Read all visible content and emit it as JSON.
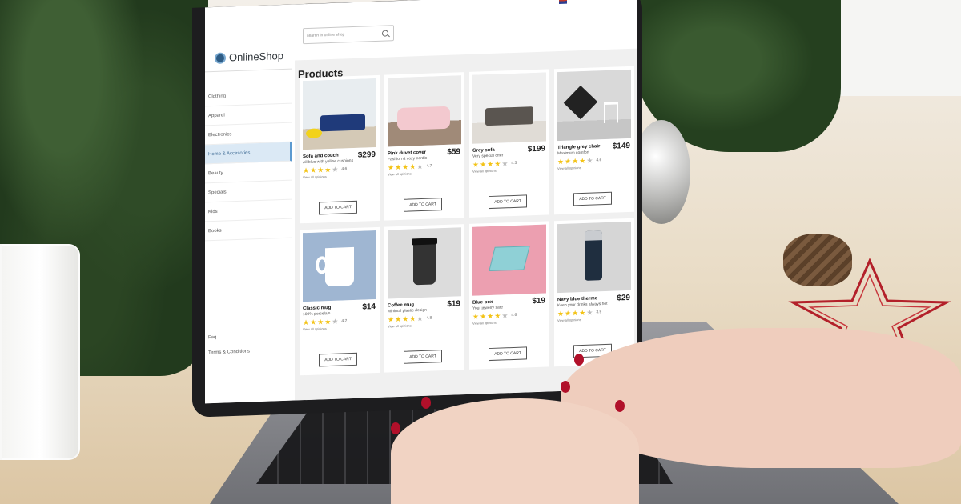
{
  "app": {
    "brand_name": "OnlineShop",
    "search_placeholder": "search in online shop"
  },
  "sidebar": {
    "items": [
      {
        "label": "Clothing",
        "active": false
      },
      {
        "label": "Apparel",
        "active": false
      },
      {
        "label": "Electronics",
        "active": false
      },
      {
        "label": "Home & Accesories",
        "active": true
      },
      {
        "label": "Beauty",
        "active": false
      },
      {
        "label": "Specials",
        "active": false
      },
      {
        "label": "Kids",
        "active": false
      },
      {
        "label": "Books",
        "active": false
      }
    ],
    "bottom_links": [
      "Faq",
      "Terms & Conditions"
    ]
  },
  "main": {
    "title": "Products",
    "add_to_cart_label": "ADD TO CART",
    "products": [
      {
        "name": "Sofa and couch",
        "desc": "All blue with yellow cushions",
        "price": "$299",
        "rating": "4.6",
        "stars": 4,
        "reviews": "View all opinions"
      },
      {
        "name": "Pink duvet cover",
        "desc": "Fashion & cozy nordic",
        "price": "$59",
        "rating": "4.7",
        "stars": 4,
        "reviews": "View all opinions"
      },
      {
        "name": "Grey sofa",
        "desc": "Very special offer",
        "price": "$199",
        "rating": "4.3",
        "stars": 4,
        "reviews": "View all opinions"
      },
      {
        "name": "Triangle grey chair",
        "desc": "Maximum comfort",
        "price": "$149",
        "rating": "4.6",
        "stars": 4,
        "reviews": "View all opinions"
      },
      {
        "name": "Classic mug",
        "desc": "100% porcelain",
        "price": "$14",
        "rating": "4.2",
        "stars": 4,
        "reviews": "View all opinions"
      },
      {
        "name": "Coffee mug",
        "desc": "Minimal plastic design",
        "price": "$19",
        "rating": "4.8",
        "stars": 4,
        "reviews": "View all opinions"
      },
      {
        "name": "Blue box",
        "desc": "Your jewelry safe",
        "price": "$19",
        "rating": "4.6",
        "stars": 4,
        "reviews": "View all opinions"
      },
      {
        "name": "Navy blue thermo",
        "desc": "Keep your drinks always hot",
        "price": "$29",
        "rating": "3.9",
        "stars": 4,
        "reviews": "View all opinions"
      }
    ]
  },
  "colors": {
    "accent": "#5c9ad0",
    "star": "#f3c316",
    "nail_polish": "#b1102a"
  }
}
